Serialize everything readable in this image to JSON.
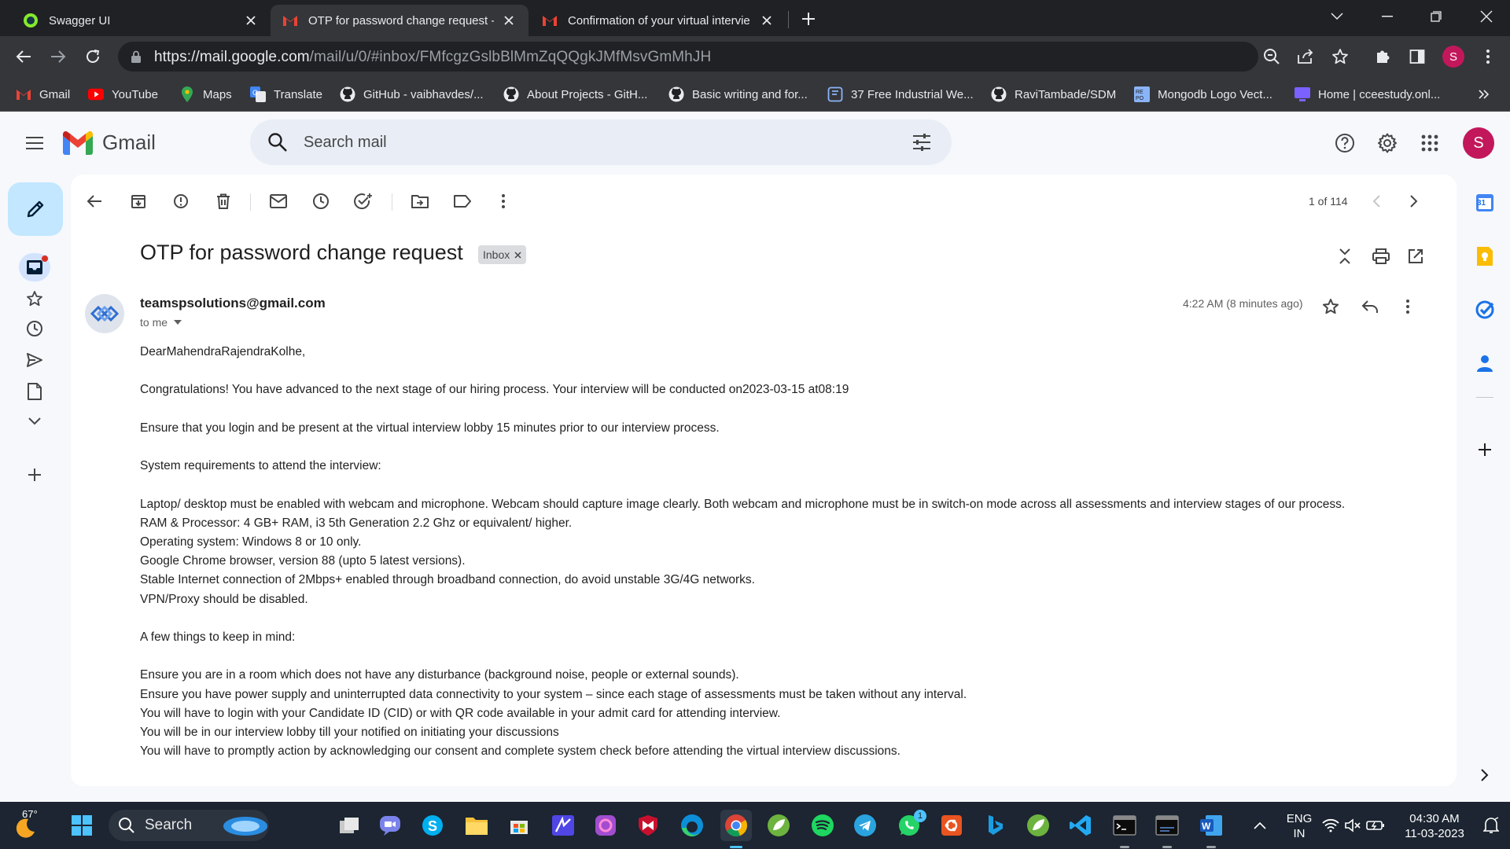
{
  "browser": {
    "tabs": [
      {
        "title": "Swagger UI",
        "icon": "swagger-icon"
      },
      {
        "title": "OTP for password change request -",
        "icon": "gmail-icon"
      },
      {
        "title": "Confirmation of your virtual intervie",
        "icon": "gmail-icon"
      }
    ],
    "url_host": "https://mail.google.com",
    "url_path": "/mail/u/0/#inbox/FMfcgzGslbBlMmZqQQgkJMfMsvGmMhJH",
    "profile_initial": "S",
    "bookmarks": [
      {
        "label": "Gmail",
        "icon": "gmail-icon"
      },
      {
        "label": "YouTube",
        "icon": "youtube-icon"
      },
      {
        "label": "Maps",
        "icon": "maps-icon"
      },
      {
        "label": "Translate",
        "icon": "translate-icon"
      },
      {
        "label": "GitHub - vaibhavdes/...",
        "icon": "github-icon"
      },
      {
        "label": "About Projects - GitH...",
        "icon": "github-icon"
      },
      {
        "label": "Basic writing and for...",
        "icon": "github-icon"
      },
      {
        "label": "37 Free Industrial We...",
        "icon": "bookmark-icon"
      },
      {
        "label": "RaviTambade/SDM",
        "icon": "github-icon"
      },
      {
        "label": "Mongodb Logo Vect...",
        "icon": "repo-icon"
      },
      {
        "label": "Home | cceestudy.onl...",
        "icon": "site-icon"
      }
    ]
  },
  "gmail": {
    "brand": "Gmail",
    "search_placeholder": "Search mail",
    "user_initial": "S",
    "pager": "1 of 114",
    "subject": "OTP for password change request",
    "label_chip": "Inbox",
    "sender": "teamspsolutions@gmail.com",
    "recipient": "to me",
    "time": "4:22 AM (8 minutes ago)",
    "body": [
      "DearMahendraRajendraKolhe,",
      "",
      "Congratulations! You have advanced to the next stage of our hiring process. Your interview will be conducted on2023-03-15 at08:19",
      "",
      "Ensure that you login and be present at the virtual interview lobby 15 minutes prior to our interview process.",
      "",
      "System requirements to attend the interview:",
      "",
      "Laptop/ desktop must be enabled with webcam and microphone. Webcam should capture image clearly. Both webcam and microphone must be in switch-on mode across all assessments and interview stages of our process.",
      "RAM & Processor: 4 GB+ RAM, i3 5th Generation 2.2 Ghz or equivalent/ higher.",
      "Operating system: Windows 8 or 10 only.",
      "Google Chrome browser, version 88 (upto 5 latest versions).",
      "Stable Internet connection of 2Mbps+ enabled through broadband connection, do avoid unstable 3G/4G networks.",
      "VPN/Proxy should be disabled.",
      "",
      "A few things to keep in mind:",
      "",
      "Ensure you are in a room which does not have any disturbance (background noise, people or external sounds).",
      "Ensure you have power supply and uninterrupted data connectivity to your system – since each stage of assessments must be taken without any interval.",
      "You will have to login with your Candidate ID (CID) or with QR code available in your admit card for attending interview.",
      "You will be in our interview lobby till your notified on initiating your discussions",
      "You will have to promptly action by acknowledging our consent and complete system check before attending the virtual interview discussions."
    ],
    "calendar_day": "31"
  },
  "taskbar": {
    "weather": "67°",
    "search_label": "Search",
    "language": "ENG",
    "region": "IN",
    "time": "04:30 AM",
    "date": "11-03-2023",
    "whatsapp_badge": "1"
  },
  "colors": {
    "gmail_red": "#ea4335",
    "compose_bg": "#c2e7ff",
    "avatar": "#c2185b",
    "chrome_dark": "#202124"
  }
}
